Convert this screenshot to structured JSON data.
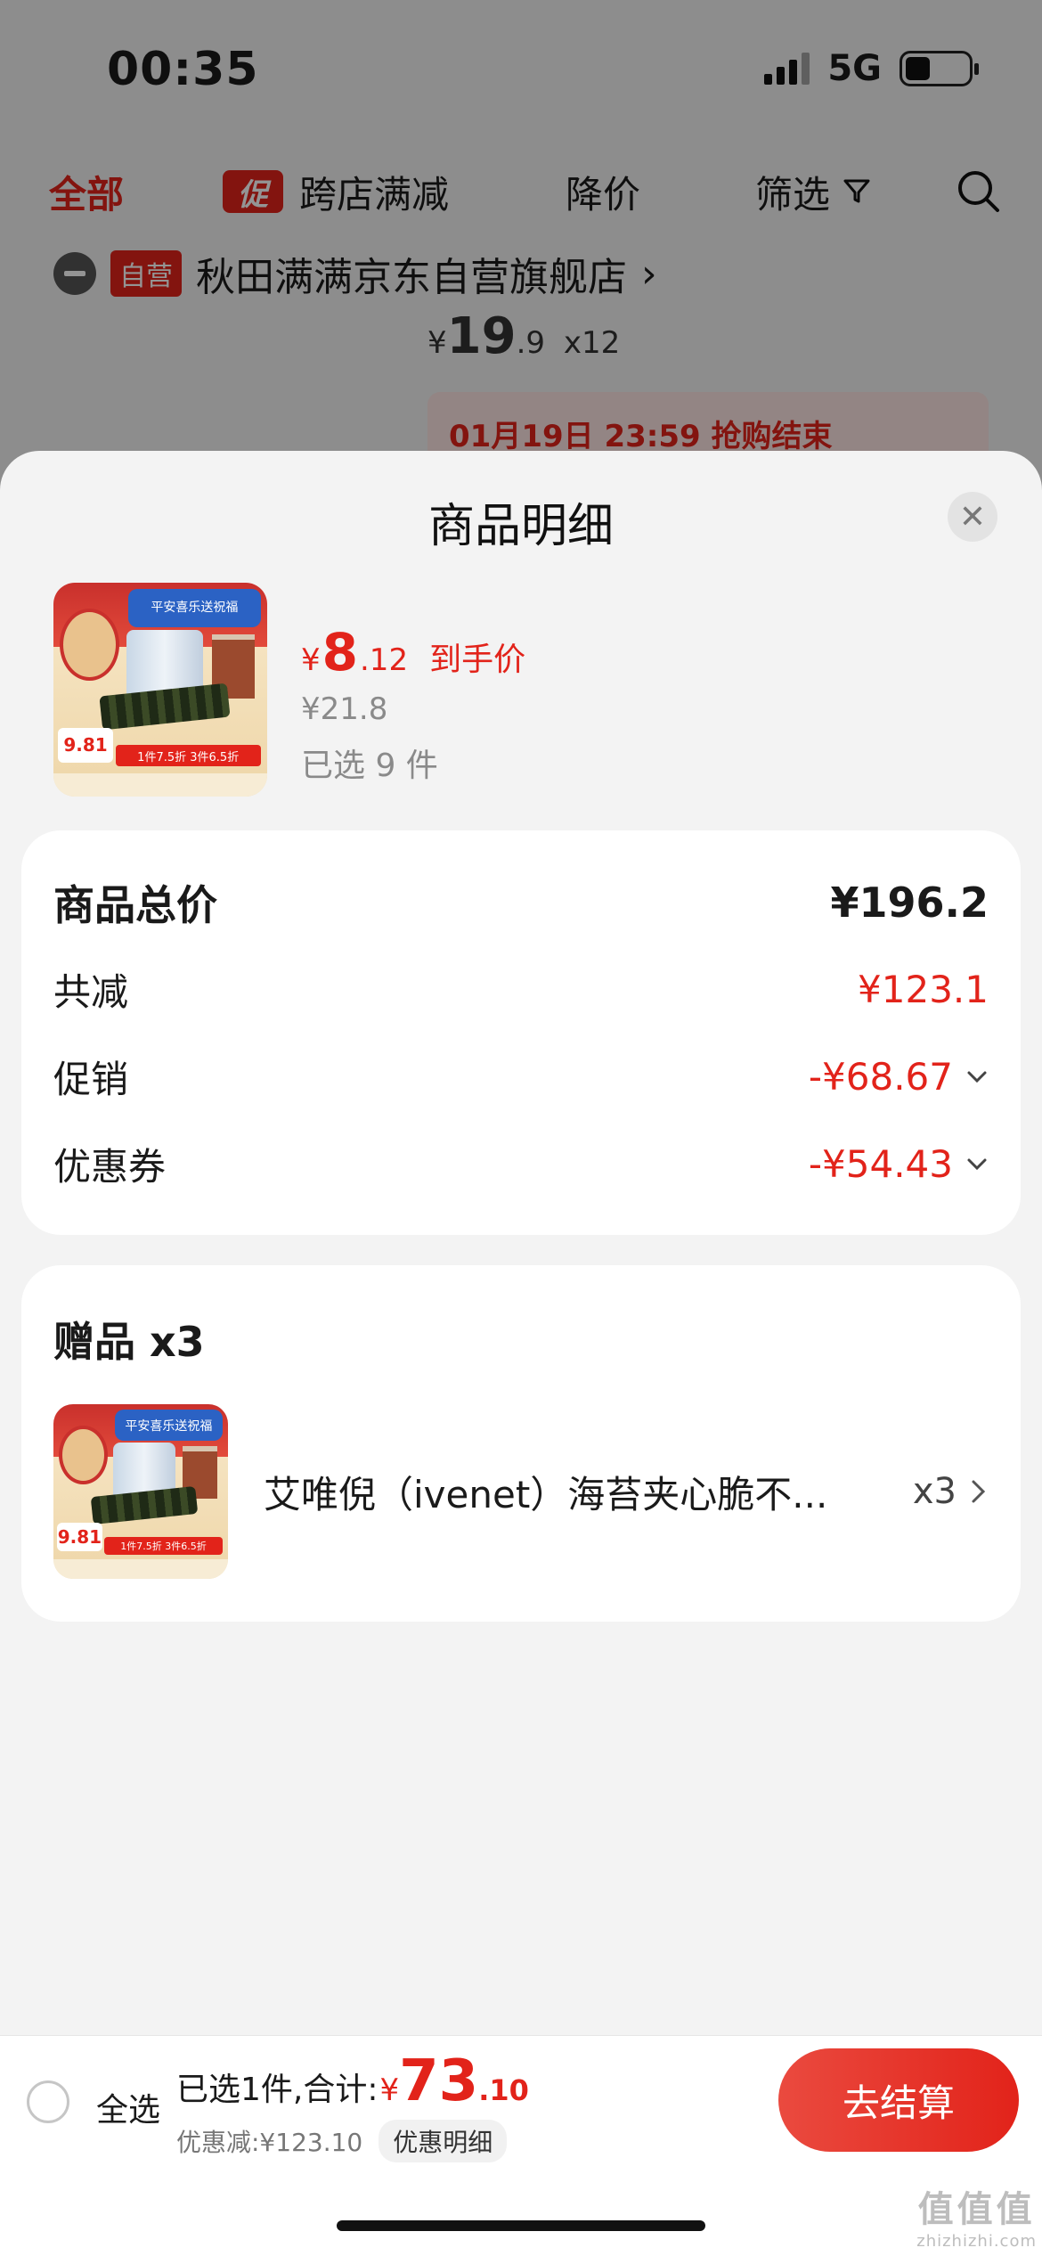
{
  "status_bar": {
    "time": "00:35",
    "network": "5G"
  },
  "filter_bar": {
    "all": "全部",
    "promo_tag": "促",
    "cross_store": "跨店满减",
    "price_drop": "降价",
    "filter": "筛选"
  },
  "shop": {
    "tag": "自营",
    "name": "秋田满满京东自营旗舰店",
    "arrow": "›"
  },
  "bg_item": {
    "currency": "¥",
    "price_int": "19",
    "price_dec": ".9",
    "qty": "x12",
    "deadline": "01月19日 23:59 抢购结束"
  },
  "sheet": {
    "title": "商品明细",
    "close": "✕",
    "product": {
      "currency": "¥",
      "price_int": "8",
      "price_dec": ".12",
      "price_label": "到手价",
      "original_price": "¥21.8",
      "selected": "已选 9 件"
    },
    "price_card": {
      "total_label": "商品总价",
      "total_value": "¥196.2",
      "reduce_label": "共减",
      "reduce_value": "¥123.1",
      "promo_label": "促销",
      "promo_value": "-¥68.67",
      "coupon_label": "优惠券",
      "coupon_value": "-¥54.43"
    },
    "gift_card": {
      "title": "赠品 x3",
      "item_name": "艾唯倪（ivenet）海苔夹心脆不...",
      "item_qty": "x3"
    },
    "image_text": {
      "banner": "平安喜乐送祝福",
      "price": "9.81",
      "strip": "1件7.5折 3件6.5折"
    }
  },
  "checkout": {
    "select_all": "全选",
    "summary_prefix": "已选1件,合计:",
    "currency": "¥",
    "total_int": "73",
    "total_dec": ".10",
    "discount_text": "优惠减:¥123.10",
    "detail_button": "优惠明细",
    "pay_button": "去结算"
  },
  "watermark": {
    "line1": "值值值",
    "line2": "zhizhizhi.com"
  },
  "colors": {
    "accent": "#e2231a",
    "sheet_bg": "#f3f3f3",
    "card_bg": "#ffffff"
  }
}
